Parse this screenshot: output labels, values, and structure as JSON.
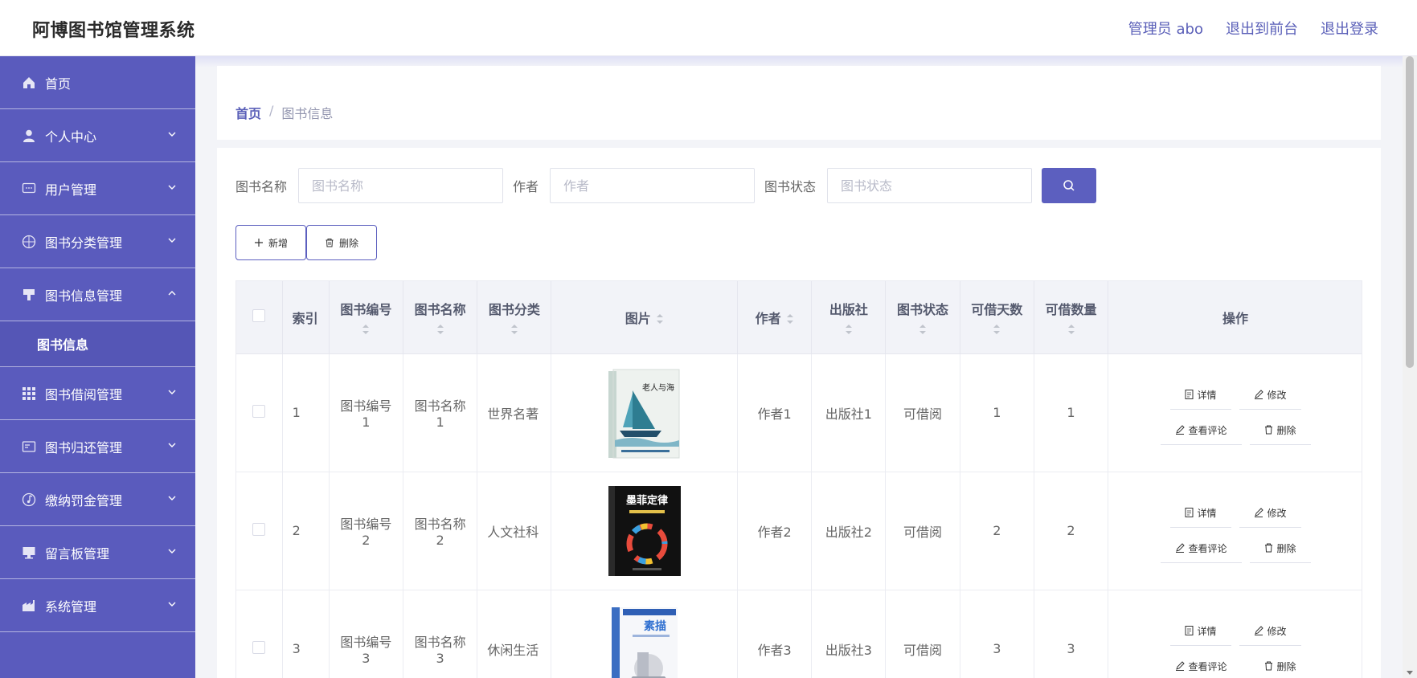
{
  "app": {
    "title": "阿博图书馆管理系统"
  },
  "header_links": {
    "admin": "管理员 abo",
    "front": "退出到前台",
    "logout": "退出登录"
  },
  "sidebar": {
    "home": "首页",
    "personal": "个人中心",
    "users": "用户管理",
    "category": "图书分类管理",
    "bookinfo": "图书信息管理",
    "bookinfo_sub": "图书信息",
    "borrow": "图书借阅管理",
    "return": "图书归还管理",
    "fine": "缴纳罚金管理",
    "board": "留言板管理",
    "system": "系统管理"
  },
  "breadcrumb": {
    "home": "首页",
    "sep": "/",
    "current": "图书信息"
  },
  "search": {
    "name_label": "图书名称",
    "name_placeholder": "图书名称",
    "author_label": "作者",
    "author_placeholder": "作者",
    "status_label": "图书状态",
    "status_placeholder": "图书状态"
  },
  "actions": {
    "add": "新增",
    "delete": "删除"
  },
  "columns": {
    "index": "索引",
    "code": "图书编号",
    "name": "图书名称",
    "category": "图书分类",
    "image": "图片",
    "author": "作者",
    "publisher": "出版社",
    "status": "图书状态",
    "days": "可借天数",
    "qty": "可借数量",
    "ops": "操作"
  },
  "op_labels": {
    "detail": "详情",
    "edit": "修改",
    "review": "查看评论",
    "delete": "删除"
  },
  "rows": [
    {
      "index": "1",
      "code": "图书编号1",
      "name": "图书名称1",
      "category": "世界名著",
      "cover_title": "老人与海",
      "author": "作者1",
      "publisher": "出版社1",
      "status": "可借阅",
      "days": "1",
      "qty": "1"
    },
    {
      "index": "2",
      "code": "图书编号2",
      "name": "图书名称2",
      "category": "人文社科",
      "cover_title": "墨菲定律",
      "author": "作者2",
      "publisher": "出版社2",
      "status": "可借阅",
      "days": "2",
      "qty": "2"
    },
    {
      "index": "3",
      "code": "图书编号3",
      "name": "图书名称3",
      "category": "休闲生活",
      "cover_title": "素描",
      "author": "作者3",
      "publisher": "出版社3",
      "status": "可借阅",
      "days": "3",
      "qty": "3"
    }
  ],
  "colors": {
    "primary": "#5a5bbd",
    "accent": "#5c5fbf",
    "link": "#5a5fb8"
  }
}
